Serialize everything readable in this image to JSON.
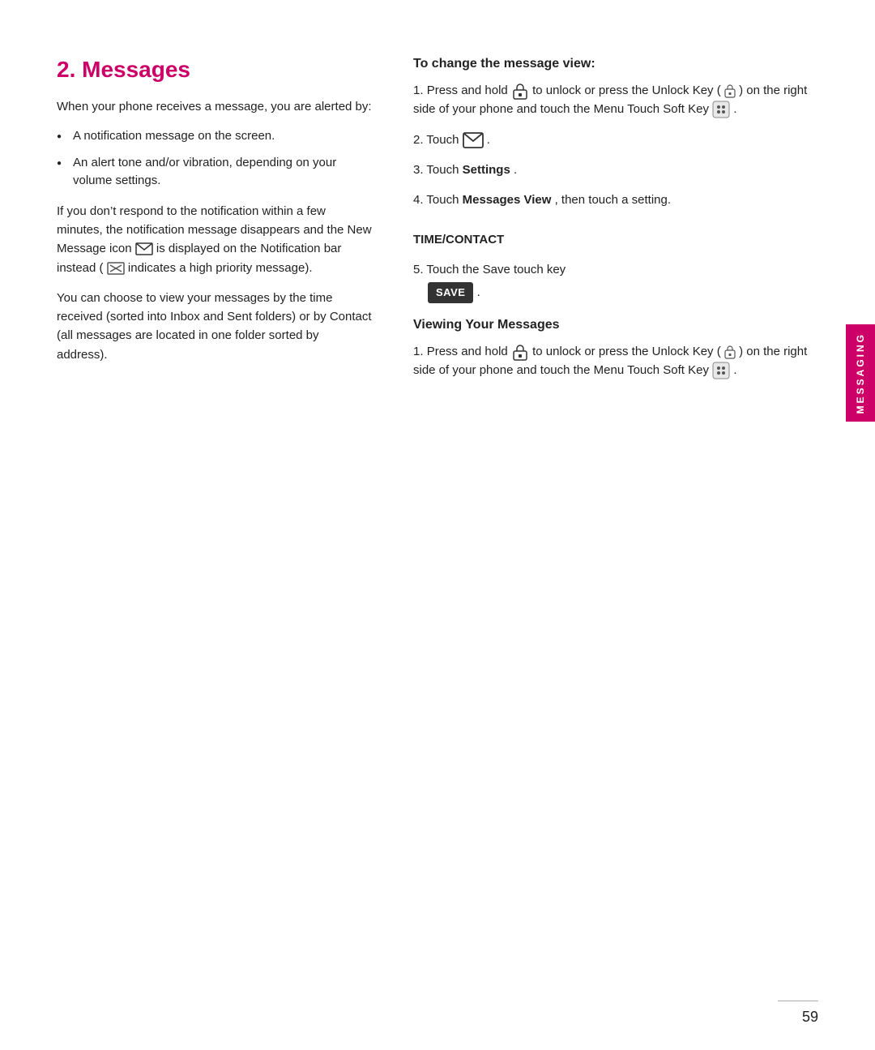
{
  "page": {
    "number": "59",
    "sidebar_label": "MESSAGING"
  },
  "section": {
    "title": "2. Messages",
    "intro1": "When your phone receives a message, you are alerted by:",
    "bullets": [
      "A notification message on the screen.",
      "An alert tone and/or vibration, depending on your volume settings."
    ],
    "para1": "If you don’t respond to the notification within a few minutes, the notification message disappears and the New Message icon",
    "para1_mid": "is displayed on the Notification bar instead (",
    "para1_end": "indicates a high priority message).",
    "para2": "You can choose to view your messages by the time received (sorted into Inbox and Sent folders) or by Contact (all messages are located in one folder sorted by address)."
  },
  "right": {
    "change_view_title": "To change the message view:",
    "steps_change": [
      {
        "num": "1.",
        "text_before": "Press and hold",
        "text_after": "to unlock or press the Unlock Key (",
        "text_end": ") on the right side of your phone and touch the Menu Touch Soft Key"
      },
      {
        "num": "2.",
        "text_before": "Touch",
        "text_after": "."
      },
      {
        "num": "3.",
        "text_before": "Touch",
        "bold": "Settings",
        "text_after": "."
      },
      {
        "num": "4.",
        "text_before": "Touch",
        "bold": "Messages View",
        "text_after": ", then touch a setting.",
        "extra": "TIME/CONTACT"
      },
      {
        "num": "5.",
        "text_before": "Touch the Save touch key"
      }
    ],
    "viewing_title": "Viewing Your Messages",
    "steps_viewing": [
      {
        "num": "1.",
        "text_before": "Press and hold",
        "text_after": "to unlock or press the Unlock Key (",
        "text_end": ") on the right side of your phone and touch the Menu Touch Soft Key"
      }
    ],
    "save_label": "SAVE"
  }
}
